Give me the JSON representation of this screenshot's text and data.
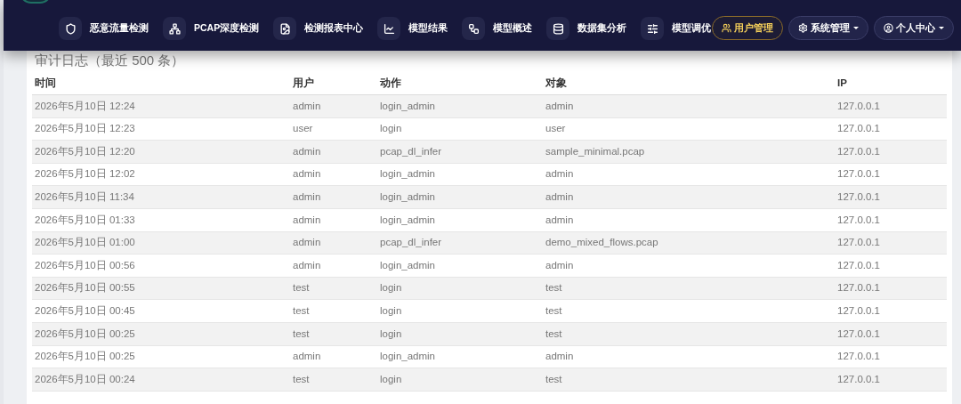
{
  "nav": {
    "items": [
      {
        "label": "恶意流量检测"
      },
      {
        "label": "PCAP深度检测"
      },
      {
        "label": "检测报表中心"
      },
      {
        "label": "模型结果"
      },
      {
        "label": "模型概述"
      },
      {
        "label": "数据集分析"
      },
      {
        "label": "模型调优"
      }
    ],
    "buttons": [
      {
        "label": "用户管理",
        "selected": true,
        "dropdown": false
      },
      {
        "label": "系统管理",
        "selected": false,
        "dropdown": true
      },
      {
        "label": "个人中心",
        "selected": false,
        "dropdown": true
      }
    ]
  },
  "heading": "审计日志（最近 500 条）",
  "table": {
    "columns": [
      "时间",
      "用户",
      "动作",
      "对象",
      "IP"
    ],
    "rows": [
      [
        "2026年5月10日 12:24",
        "admin",
        "login_admin",
        "admin",
        "127.0.0.1"
      ],
      [
        "2026年5月10日 12:23",
        "user",
        "login",
        "user",
        "127.0.0.1"
      ],
      [
        "2026年5月10日 12:20",
        "admin",
        "pcap_dl_infer",
        "sample_minimal.pcap",
        "127.0.0.1"
      ],
      [
        "2026年5月10日 12:02",
        "admin",
        "login_admin",
        "admin",
        "127.0.0.1"
      ],
      [
        "2026年5月10日 11:34",
        "admin",
        "login_admin",
        "admin",
        "127.0.0.1"
      ],
      [
        "2026年5月10日 01:33",
        "admin",
        "login_admin",
        "admin",
        "127.0.0.1"
      ],
      [
        "2026年5月10日 01:00",
        "admin",
        "pcap_dl_infer",
        "demo_mixed_flows.pcap",
        "127.0.0.1"
      ],
      [
        "2026年5月10日 00:56",
        "admin",
        "login_admin",
        "admin",
        "127.0.0.1"
      ],
      [
        "2026年5月10日 00:55",
        "test",
        "login",
        "test",
        "127.0.0.1"
      ],
      [
        "2026年5月10日 00:45",
        "test",
        "login",
        "test",
        "127.0.0.1"
      ],
      [
        "2026年5月10日 00:25",
        "test",
        "login",
        "test",
        "127.0.0.1"
      ],
      [
        "2026年5月10日 00:25",
        "admin",
        "login_admin",
        "admin",
        "127.0.0.1"
      ],
      [
        "2026年5月10日 00:24",
        "test",
        "login",
        "test",
        "127.0.0.1"
      ]
    ]
  }
}
